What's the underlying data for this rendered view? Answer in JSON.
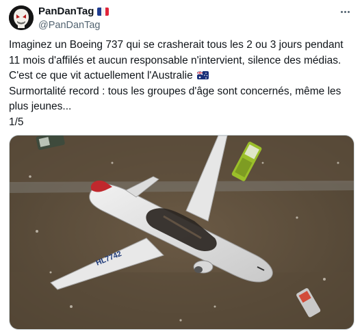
{
  "author": {
    "display_name": "PanDanTag",
    "handle": "@PanDanTag",
    "name_flag_icon": "flag-france-icon",
    "avatar_icon": "skull-mask-avatar-icon"
  },
  "more_icon": "more-options-icon",
  "tweet": {
    "line1": "Imaginez un Boeing 737 qui se crasherait tous les 2 ou 3 jours pendant 11 mois d'affilés et aucun responsable n'intervient, silence des médias.",
    "line2": "C'est ce que vit actuellement l'Australie",
    "line2_flag_icon": "flag-australia-icon",
    "line3": "Surmortalité record : tous les groupes d'âge sont concernés, même les plus jeunes...",
    "line4": "1/5"
  },
  "media": {
    "plane_registration": "HL7742",
    "icon": "crashed-airplane-photo"
  },
  "colors": {
    "text": "#0f1419",
    "secondary": "#536471",
    "border": "#cfd9de"
  }
}
